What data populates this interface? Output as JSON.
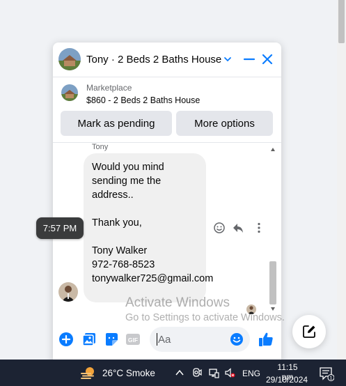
{
  "chat": {
    "title": "Tony · 2 Beds 2 Baths House",
    "marketplace_label": "Marketplace",
    "listing_title": "$860 - 2 Beds 2 Baths House",
    "mark_pending_label": "Mark as pending",
    "more_options_label": "More options"
  },
  "message": {
    "sender": "Tony",
    "text": "Would you mind sending me the address..\n\nThank you,\n\nTony Walker\n972-768-8523\ntonywalker725@gmail.com",
    "time_tooltip": "7:57 PM"
  },
  "composer": {
    "placeholder": "Aa"
  },
  "watermark": {
    "line1": "Activate Windows",
    "line2": "Go to Settings to activate Windows."
  },
  "taskbar": {
    "weather": "26°C  Smoke",
    "language": "ENG",
    "time": "11:15 pm",
    "date": "29/10/2024",
    "notification_count": "1"
  },
  "colors": {
    "messenger_blue": "#0a7cff",
    "bubble_gray": "#f0f0f0",
    "taskbar": "#1c2333"
  },
  "icons": [
    "chevron-down-icon",
    "minimize-icon",
    "close-icon",
    "react-icon",
    "reply-icon",
    "more-icon",
    "plus-icon",
    "photo-icon",
    "sticker-icon",
    "gif-icon",
    "emoji-icon",
    "like-icon",
    "new-message-icon",
    "weather-icon",
    "chevron-up-icon",
    "network-icon",
    "volume-muted-icon",
    "notification-icon"
  ]
}
